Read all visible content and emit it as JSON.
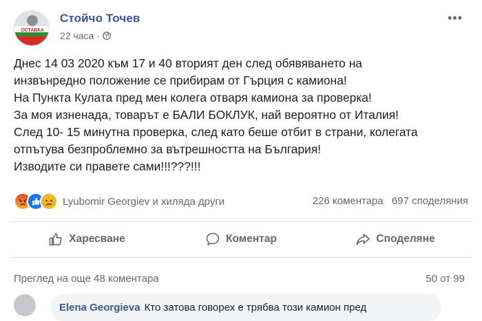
{
  "post": {
    "author": "Стойчо Точев",
    "time": "22 часа",
    "privacy_icon": "globe-icon",
    "avatar_text": "ОСТАВКА",
    "more_label": "•••",
    "lines": [
      "Днес 14 03 2020 към 17 и 40 вторият ден след обявяването на",
      "инзвънредно положение се прибирам от Гърция с камиона!",
      "На Пункта Кулата пред мен колега отваря камиона за проверка!",
      "За моя изненада, товарът е БАЛИ БОКЛУК, най вероятно от Италия!",
      "След 10- 15 минутна проверка, след като беше отбит в страни, колегата",
      "отпътува безпроблемно за вътрешността на България!",
      "Изводите си правете сами!!!???!!!"
    ]
  },
  "reactions": {
    "icons": [
      "angry-reaction-icon",
      "like-reaction-icon",
      "sad-reaction-icon"
    ],
    "names": "Lyubomir Georgiev и хиляда други",
    "comments_count": "226 коментара",
    "shares_count": "697 споделяния"
  },
  "actions": {
    "like": "Харесване",
    "comment": "Коментар",
    "share": "Споделяне"
  },
  "comments": {
    "view_more": "Преглед на още 48 коментара",
    "counter": "50 от 99",
    "first_author": "Elena Georgieva",
    "first_text": "Кто затова говорех е трябва този камион пред"
  },
  "colors": {
    "author_link": "#385898",
    "muted_text": "#606770",
    "like_blue": "#1877f2",
    "angry_red": "#e9710f",
    "sad_yellow": "#f7b125"
  }
}
